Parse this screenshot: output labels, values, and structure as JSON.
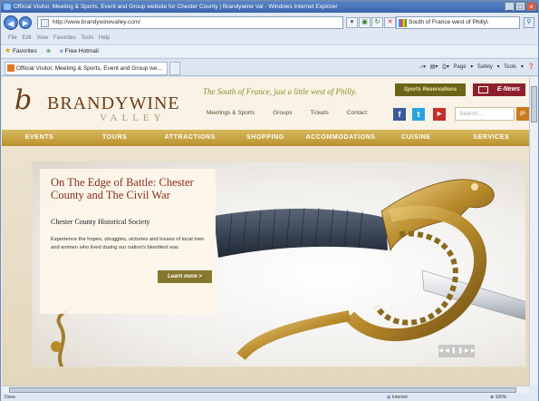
{
  "browser": {
    "title": "Official Visitor, Meeting & Sports, Event and Group website for Chester County | Brandywine Val - Windows Internet Explorer",
    "url": "http://www.brandywinevalley.com/",
    "search_text": "South of France west of Philly\\",
    "menu": [
      "File",
      "Edit",
      "View",
      "Favorites",
      "Tools",
      "Help"
    ],
    "favorites_label": "Favorites",
    "fav_link": "Free Hotmail",
    "tab_label": "Official Visitor, Meeting & Sports, Event and Group we...",
    "command_bar": [
      "Page ▾",
      "Safety ▾",
      "Tools ▾"
    ],
    "status_left": "Done",
    "status_zone": "Internet",
    "status_zoom": "100%"
  },
  "site": {
    "brand": "BRANDYWINE",
    "brand_sub": "VALLEY",
    "tagline": "The South of France, just a little west of Philly.",
    "sports_btn": "Sports Reservations",
    "enews_btn": "E-News",
    "top_links": [
      "Meetings & Sports",
      "Groups",
      "Tickets",
      "Contact"
    ],
    "search_placeholder": "Search...",
    "search_go": "go",
    "nav": [
      "EVENTS",
      "TOURS",
      "ATTRACTIONS",
      "SHOPPING",
      "ACCOMMODATIONS",
      "CUISINE",
      "SERVICES"
    ],
    "hero": {
      "title": "On The Edge of Battle: Chester County and The Civil War",
      "subtitle": "Chester County Historical Society",
      "body": "Experience the hopes, struggles, victories and losses of local men and women who lived during our nation's bloodiest war.",
      "cta": "Learn more >"
    }
  },
  "colors": {
    "brand_brown": "#6e3b16",
    "nav_gold": "#c8a546",
    "headline_red": "#8b2a1e",
    "enews_red": "#8e1f2c"
  }
}
